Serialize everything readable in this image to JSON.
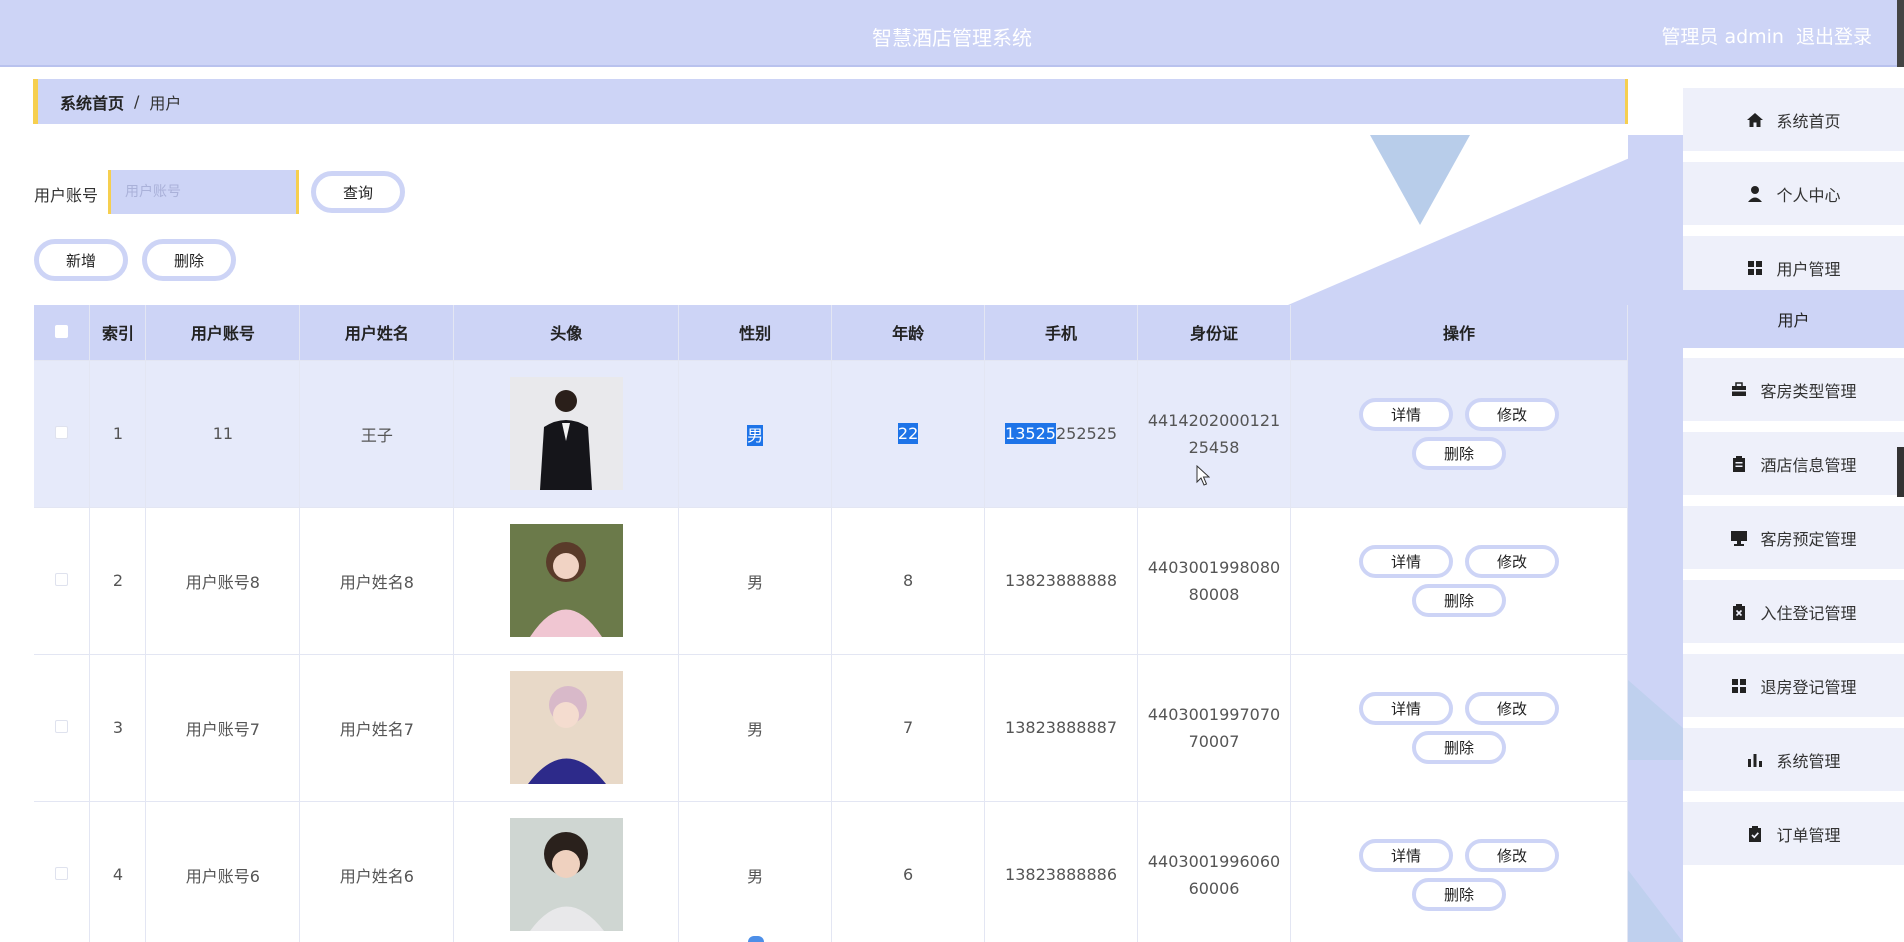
{
  "header": {
    "title": "智慧酒店管理系统",
    "user_label": "管理员 admin",
    "logout_label": "退出登录"
  },
  "breadcrumb": {
    "home": "系统首页",
    "separator": "/",
    "current": "用户"
  },
  "search": {
    "label": "用户账号",
    "placeholder": "用户账号",
    "query_button": "查询"
  },
  "actions": {
    "add_button": "新增",
    "delete_button": "删除"
  },
  "table": {
    "headers": [
      "索引",
      "用户账号",
      "用户姓名",
      "头像",
      "性别",
      "年龄",
      "手机",
      "身份证",
      "操作"
    ],
    "rows": [
      {
        "index": "1",
        "account": "11",
        "name": "王子",
        "gender": "男",
        "age": "22",
        "phone_selected": "13525",
        "phone_rest": "252525",
        "idcard": "441420200012125458"
      },
      {
        "index": "2",
        "account": "用户账号8",
        "name": "用户姓名8",
        "gender": "男",
        "age": "8",
        "phone": "13823888888",
        "idcard": "440300199808080008"
      },
      {
        "index": "3",
        "account": "用户账号7",
        "name": "用户姓名7",
        "gender": "男",
        "age": "7",
        "phone": "13823888887",
        "idcard": "440300199707070007"
      },
      {
        "index": "4",
        "account": "用户账号6",
        "name": "用户姓名6",
        "gender": "男",
        "age": "6",
        "phone": "13823888886",
        "idcard": "440300199606060006"
      }
    ],
    "op_detail": "详情",
    "op_edit": "修改",
    "op_delete": "删除"
  },
  "sidebar": {
    "items": [
      {
        "label": "系统首页",
        "icon": "home-icon"
      },
      {
        "label": "个人中心",
        "icon": "user-icon"
      },
      {
        "label": "用户管理",
        "icon": "grid-icon"
      },
      {
        "label": "客房类型管理",
        "icon": "briefcase-icon"
      },
      {
        "label": "酒店信息管理",
        "icon": "clipboard-icon"
      },
      {
        "label": "客房预定管理",
        "icon": "monitor-icon"
      },
      {
        "label": "入住登记管理",
        "icon": "clipboard-x-icon"
      },
      {
        "label": "退房登记管理",
        "icon": "grid-icon"
      },
      {
        "label": "系统管理",
        "icon": "bar-chart-icon"
      },
      {
        "label": "订单管理",
        "icon": "clipboard-check-icon"
      }
    ],
    "sub_item": "用户"
  },
  "colors": {
    "accent": "#cdd4f6",
    "highlight": "#f6cf4f",
    "selection": "#1e74e8"
  }
}
